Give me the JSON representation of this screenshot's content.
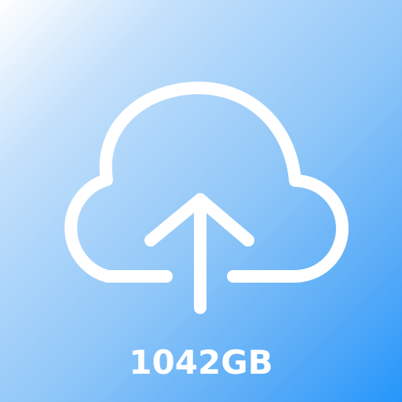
{
  "icon": {
    "name": "cloud-upload-icon",
    "stroke_color": "#ffffff"
  },
  "background": {
    "gradient_start": "#ffffff",
    "gradient_end": "#2496fb"
  },
  "storage": {
    "size_label": "1042GB"
  }
}
